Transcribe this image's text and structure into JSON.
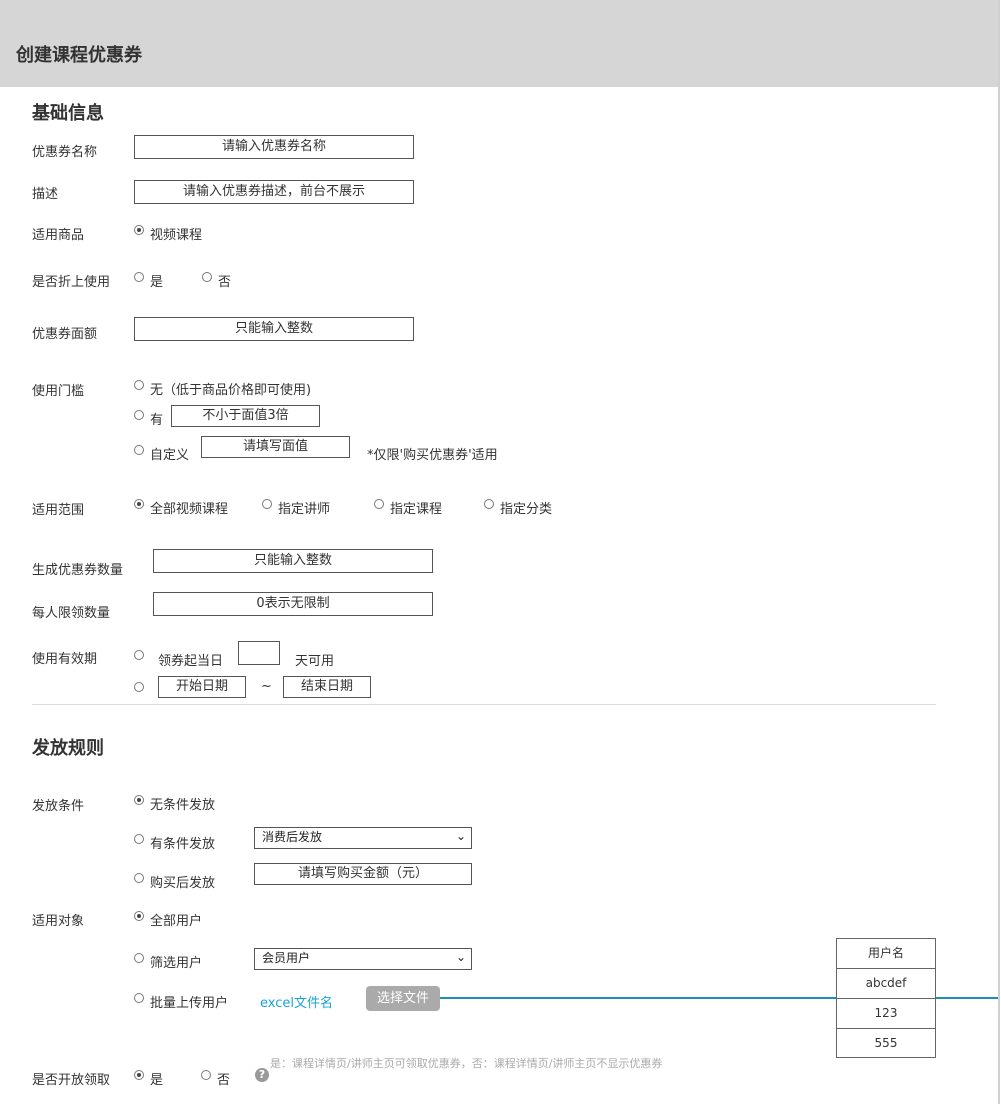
{
  "page": {
    "title": "创建课程优惠券"
  },
  "basic": {
    "section_title": "基础信息",
    "name_label": "优惠券名称",
    "name_placeholder": "请输入优惠券名称",
    "desc_label": "描述",
    "desc_placeholder": "请输入优惠券描述，前台不展示",
    "goods_label": "适用商品",
    "goods_option": "视频课程",
    "discount_label": "是否折上使用",
    "discount_yes": "是",
    "discount_no": "否",
    "face_label": "优惠券面额",
    "face_placeholder": "只能输入整数",
    "threshold_label": "使用门槛",
    "threshold_none": "无（低于商品价格即可使用)",
    "threshold_has": "有",
    "threshold_has_placeholder": "不小于面值3倍",
    "threshold_custom": "自定义",
    "threshold_custom_placeholder": "请填写面值",
    "threshold_note": "*仅限'购买优惠券'适用",
    "scope_label": "适用范围",
    "scope_options": [
      "全部视频课程",
      "指定讲师",
      "指定课程",
      "指定分类"
    ],
    "count_label": "生成优惠券数量",
    "count_placeholder": "只能输入整数",
    "limit_label": "每人限领数量",
    "limit_placeholder": "0表示无限制",
    "validity_label": "使用有效期",
    "validity_from_text": "领券起当日",
    "validity_days_text": "天可用",
    "start_date": "开始日期",
    "tilde": "~",
    "end_date": "结束日期"
  },
  "rules": {
    "section_title": "发放规则",
    "cond_label": "发放条件",
    "cond_unconditional": "无条件发放",
    "cond_conditional": "有条件发放",
    "cond_select_value": "消费后发放",
    "cond_after_purchase": "购买后发放",
    "purchase_placeholder": "请填写购买金额（元）",
    "target_label": "适用对象",
    "target_all": "全部用户",
    "target_filter": "筛选用户",
    "target_select_value": "会员用户",
    "target_upload": "批量上传用户",
    "excel_file": "excel文件名",
    "choose_file": "选择文件",
    "table_header": "用户名",
    "table_rows": [
      "abcdef",
      "123",
      "555"
    ],
    "open_label": "是否开放领取",
    "open_yes": "是",
    "open_no": "否",
    "help_glyph": "?",
    "hint": "是：课程详情页/讲师主页可领取优惠券，否：课程详情页/讲师主页不显示优惠券"
  },
  "colors": {
    "header_bg": "#d6d6d6",
    "link": "#1aa3d6",
    "line": "#1b8fb8",
    "button_bg": "#aaaaaa"
  },
  "icons": {
    "dropdown": "chevron-down-icon",
    "help": "question-circle-icon"
  }
}
